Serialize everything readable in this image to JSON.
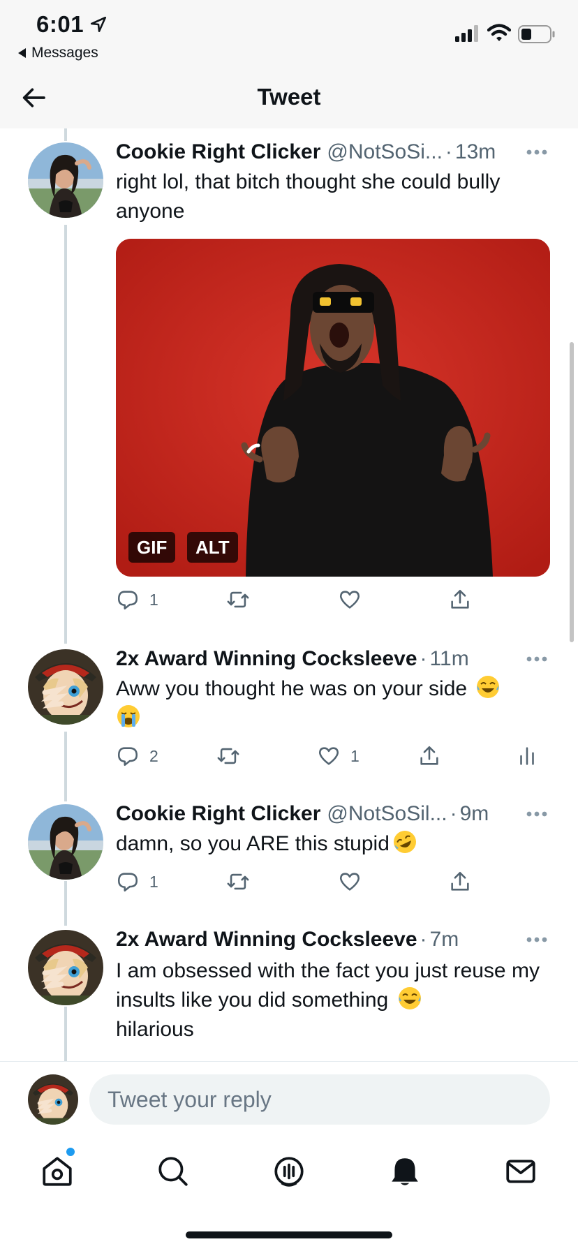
{
  "status_bar": {
    "time": "6:01",
    "back_app": "Messages"
  },
  "header": {
    "title": "Tweet"
  },
  "tweets": [
    {
      "name": "Cookie Right Clicker",
      "handle": "@NotSoSi...",
      "dot": "·",
      "time": "13m",
      "text": "right lol, that bitch thought she could bully anyone",
      "media": {
        "badge_gif": "GIF",
        "badge_alt": "ALT"
      },
      "replies": "1",
      "retweets": "",
      "likes": ""
    },
    {
      "name": "2x Award Winning Cocksleeve",
      "dot": "·",
      "time": "11m",
      "text": "Aww you thought he was on your side",
      "replies": "2",
      "retweets": "",
      "likes": "1"
    },
    {
      "name": "Cookie Right Clicker",
      "handle": "@NotSoSil...",
      "dot": "·",
      "time": "9m",
      "text": "damn, so you ARE this stupid",
      "replies": "1",
      "retweets": "",
      "likes": ""
    },
    {
      "name": "2x Award Winning Cocksleeve",
      "dot": "·",
      "time": "7m",
      "text": "I am obsessed with the fact you just reuse my insults like you did something",
      "text_end": "hilarious"
    }
  ],
  "reply": {
    "placeholder": "Tweet your reply"
  },
  "tab_bar": [
    "home-icon",
    "search-icon",
    "spaces-icon",
    "notifications-icon",
    "messages-icon"
  ],
  "colors": {
    "accent": "#1d9bf0",
    "media_bg": "#c92a20",
    "muted": "#536471"
  }
}
